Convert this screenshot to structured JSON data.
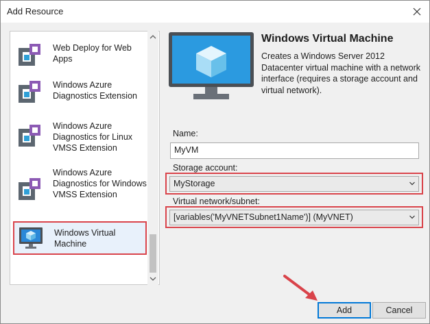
{
  "window": {
    "title": "Add Resource"
  },
  "resource_list": {
    "items": [
      {
        "label": "Web Deploy for Web Apps",
        "icon": "web-deploy-icon",
        "selected": false
      },
      {
        "label": "Windows Azure Diagnostics Extension",
        "icon": "diagnostics-extension-icon",
        "selected": false
      },
      {
        "label": "Windows Azure Diagnostics for Linux VMSS Extension",
        "icon": "diagnostics-extension-icon",
        "selected": false
      },
      {
        "label": "Windows Azure Diagnostics for Windows VMSS Extension",
        "icon": "diagnostics-extension-icon",
        "selected": false
      },
      {
        "label": "Windows Virtual Machine",
        "icon": "virtual-machine-icon",
        "selected": true
      }
    ]
  },
  "details": {
    "title": "Windows Virtual Machine",
    "description": "Creates a Windows Server 2012 Datacenter virtual machine with a network interface (requires a storage account and virtual network)."
  },
  "form": {
    "name_label": "Name:",
    "name_value": "MyVM",
    "storage_label": "Storage account:",
    "storage_value": "MyStorage",
    "vnet_label": "Virtual network/subnet:",
    "vnet_value": "[variables('MyVNETSubnet1Name')] (MyVNET)"
  },
  "buttons": {
    "add": "Add",
    "cancel": "Cancel"
  },
  "colors": {
    "highlight_border": "#d9434a",
    "accent": "#0078d7",
    "vm_cube": "#5fb8e6"
  }
}
